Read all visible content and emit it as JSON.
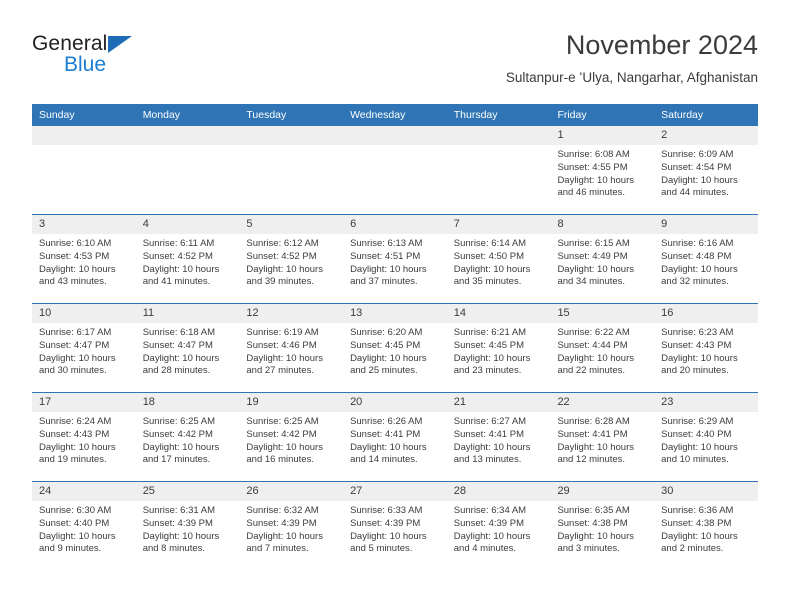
{
  "brand": {
    "name_part1": "General",
    "name_part2": "Blue",
    "triangle_color": "#1e6cb5",
    "blue_color": "#1a7fd4"
  },
  "header": {
    "title": "November 2024",
    "subtitle": "Sultanpur-e ʻUlya, Nangarhar, Afghanistan"
  },
  "theme": {
    "header_blue": "#2f75b5",
    "daynum_gray": "#efefef",
    "text": "#3c3c3c"
  },
  "weekdays": [
    "Sunday",
    "Monday",
    "Tuesday",
    "Wednesday",
    "Thursday",
    "Friday",
    "Saturday"
  ],
  "labels": {
    "sunrise_prefix": "Sunrise:",
    "sunset_prefix": "Sunset:",
    "daylight_prefix": "Daylight:"
  },
  "weeks": [
    [
      {
        "day": "",
        "sunrise": "",
        "sunset": "",
        "daylight_line1": "",
        "daylight_line2": ""
      },
      {
        "day": "",
        "sunrise": "",
        "sunset": "",
        "daylight_line1": "",
        "daylight_line2": ""
      },
      {
        "day": "",
        "sunrise": "",
        "sunset": "",
        "daylight_line1": "",
        "daylight_line2": ""
      },
      {
        "day": "",
        "sunrise": "",
        "sunset": "",
        "daylight_line1": "",
        "daylight_line2": ""
      },
      {
        "day": "",
        "sunrise": "",
        "sunset": "",
        "daylight_line1": "",
        "daylight_line2": ""
      },
      {
        "day": "1",
        "sunrise": "Sunrise: 6:08 AM",
        "sunset": "Sunset: 4:55 PM",
        "daylight_line1": "Daylight: 10 hours",
        "daylight_line2": "and 46 minutes."
      },
      {
        "day": "2",
        "sunrise": "Sunrise: 6:09 AM",
        "sunset": "Sunset: 4:54 PM",
        "daylight_line1": "Daylight: 10 hours",
        "daylight_line2": "and 44 minutes."
      }
    ],
    [
      {
        "day": "3",
        "sunrise": "Sunrise: 6:10 AM",
        "sunset": "Sunset: 4:53 PM",
        "daylight_line1": "Daylight: 10 hours",
        "daylight_line2": "and 43 minutes."
      },
      {
        "day": "4",
        "sunrise": "Sunrise: 6:11 AM",
        "sunset": "Sunset: 4:52 PM",
        "daylight_line1": "Daylight: 10 hours",
        "daylight_line2": "and 41 minutes."
      },
      {
        "day": "5",
        "sunrise": "Sunrise: 6:12 AM",
        "sunset": "Sunset: 4:52 PM",
        "daylight_line1": "Daylight: 10 hours",
        "daylight_line2": "and 39 minutes."
      },
      {
        "day": "6",
        "sunrise": "Sunrise: 6:13 AM",
        "sunset": "Sunset: 4:51 PM",
        "daylight_line1": "Daylight: 10 hours",
        "daylight_line2": "and 37 minutes."
      },
      {
        "day": "7",
        "sunrise": "Sunrise: 6:14 AM",
        "sunset": "Sunset: 4:50 PM",
        "daylight_line1": "Daylight: 10 hours",
        "daylight_line2": "and 35 minutes."
      },
      {
        "day": "8",
        "sunrise": "Sunrise: 6:15 AM",
        "sunset": "Sunset: 4:49 PM",
        "daylight_line1": "Daylight: 10 hours",
        "daylight_line2": "and 34 minutes."
      },
      {
        "day": "9",
        "sunrise": "Sunrise: 6:16 AM",
        "sunset": "Sunset: 4:48 PM",
        "daylight_line1": "Daylight: 10 hours",
        "daylight_line2": "and 32 minutes."
      }
    ],
    [
      {
        "day": "10",
        "sunrise": "Sunrise: 6:17 AM",
        "sunset": "Sunset: 4:47 PM",
        "daylight_line1": "Daylight: 10 hours",
        "daylight_line2": "and 30 minutes."
      },
      {
        "day": "11",
        "sunrise": "Sunrise: 6:18 AM",
        "sunset": "Sunset: 4:47 PM",
        "daylight_line1": "Daylight: 10 hours",
        "daylight_line2": "and 28 minutes."
      },
      {
        "day": "12",
        "sunrise": "Sunrise: 6:19 AM",
        "sunset": "Sunset: 4:46 PM",
        "daylight_line1": "Daylight: 10 hours",
        "daylight_line2": "and 27 minutes."
      },
      {
        "day": "13",
        "sunrise": "Sunrise: 6:20 AM",
        "sunset": "Sunset: 4:45 PM",
        "daylight_line1": "Daylight: 10 hours",
        "daylight_line2": "and 25 minutes."
      },
      {
        "day": "14",
        "sunrise": "Sunrise: 6:21 AM",
        "sunset": "Sunset: 4:45 PM",
        "daylight_line1": "Daylight: 10 hours",
        "daylight_line2": "and 23 minutes."
      },
      {
        "day": "15",
        "sunrise": "Sunrise: 6:22 AM",
        "sunset": "Sunset: 4:44 PM",
        "daylight_line1": "Daylight: 10 hours",
        "daylight_line2": "and 22 minutes."
      },
      {
        "day": "16",
        "sunrise": "Sunrise: 6:23 AM",
        "sunset": "Sunset: 4:43 PM",
        "daylight_line1": "Daylight: 10 hours",
        "daylight_line2": "and 20 minutes."
      }
    ],
    [
      {
        "day": "17",
        "sunrise": "Sunrise: 6:24 AM",
        "sunset": "Sunset: 4:43 PM",
        "daylight_line1": "Daylight: 10 hours",
        "daylight_line2": "and 19 minutes."
      },
      {
        "day": "18",
        "sunrise": "Sunrise: 6:25 AM",
        "sunset": "Sunset: 4:42 PM",
        "daylight_line1": "Daylight: 10 hours",
        "daylight_line2": "and 17 minutes."
      },
      {
        "day": "19",
        "sunrise": "Sunrise: 6:25 AM",
        "sunset": "Sunset: 4:42 PM",
        "daylight_line1": "Daylight: 10 hours",
        "daylight_line2": "and 16 minutes."
      },
      {
        "day": "20",
        "sunrise": "Sunrise: 6:26 AM",
        "sunset": "Sunset: 4:41 PM",
        "daylight_line1": "Daylight: 10 hours",
        "daylight_line2": "and 14 minutes."
      },
      {
        "day": "21",
        "sunrise": "Sunrise: 6:27 AM",
        "sunset": "Sunset: 4:41 PM",
        "daylight_line1": "Daylight: 10 hours",
        "daylight_line2": "and 13 minutes."
      },
      {
        "day": "22",
        "sunrise": "Sunrise: 6:28 AM",
        "sunset": "Sunset: 4:41 PM",
        "daylight_line1": "Daylight: 10 hours",
        "daylight_line2": "and 12 minutes."
      },
      {
        "day": "23",
        "sunrise": "Sunrise: 6:29 AM",
        "sunset": "Sunset: 4:40 PM",
        "daylight_line1": "Daylight: 10 hours",
        "daylight_line2": "and 10 minutes."
      }
    ],
    [
      {
        "day": "24",
        "sunrise": "Sunrise: 6:30 AM",
        "sunset": "Sunset: 4:40 PM",
        "daylight_line1": "Daylight: 10 hours",
        "daylight_line2": "and 9 minutes."
      },
      {
        "day": "25",
        "sunrise": "Sunrise: 6:31 AM",
        "sunset": "Sunset: 4:39 PM",
        "daylight_line1": "Daylight: 10 hours",
        "daylight_line2": "and 8 minutes."
      },
      {
        "day": "26",
        "sunrise": "Sunrise: 6:32 AM",
        "sunset": "Sunset: 4:39 PM",
        "daylight_line1": "Daylight: 10 hours",
        "daylight_line2": "and 7 minutes."
      },
      {
        "day": "27",
        "sunrise": "Sunrise: 6:33 AM",
        "sunset": "Sunset: 4:39 PM",
        "daylight_line1": "Daylight: 10 hours",
        "daylight_line2": "and 5 minutes."
      },
      {
        "day": "28",
        "sunrise": "Sunrise: 6:34 AM",
        "sunset": "Sunset: 4:39 PM",
        "daylight_line1": "Daylight: 10 hours",
        "daylight_line2": "and 4 minutes."
      },
      {
        "day": "29",
        "sunrise": "Sunrise: 6:35 AM",
        "sunset": "Sunset: 4:38 PM",
        "daylight_line1": "Daylight: 10 hours",
        "daylight_line2": "and 3 minutes."
      },
      {
        "day": "30",
        "sunrise": "Sunrise: 6:36 AM",
        "sunset": "Sunset: 4:38 PM",
        "daylight_line1": "Daylight: 10 hours",
        "daylight_line2": "and 2 minutes."
      }
    ]
  ]
}
